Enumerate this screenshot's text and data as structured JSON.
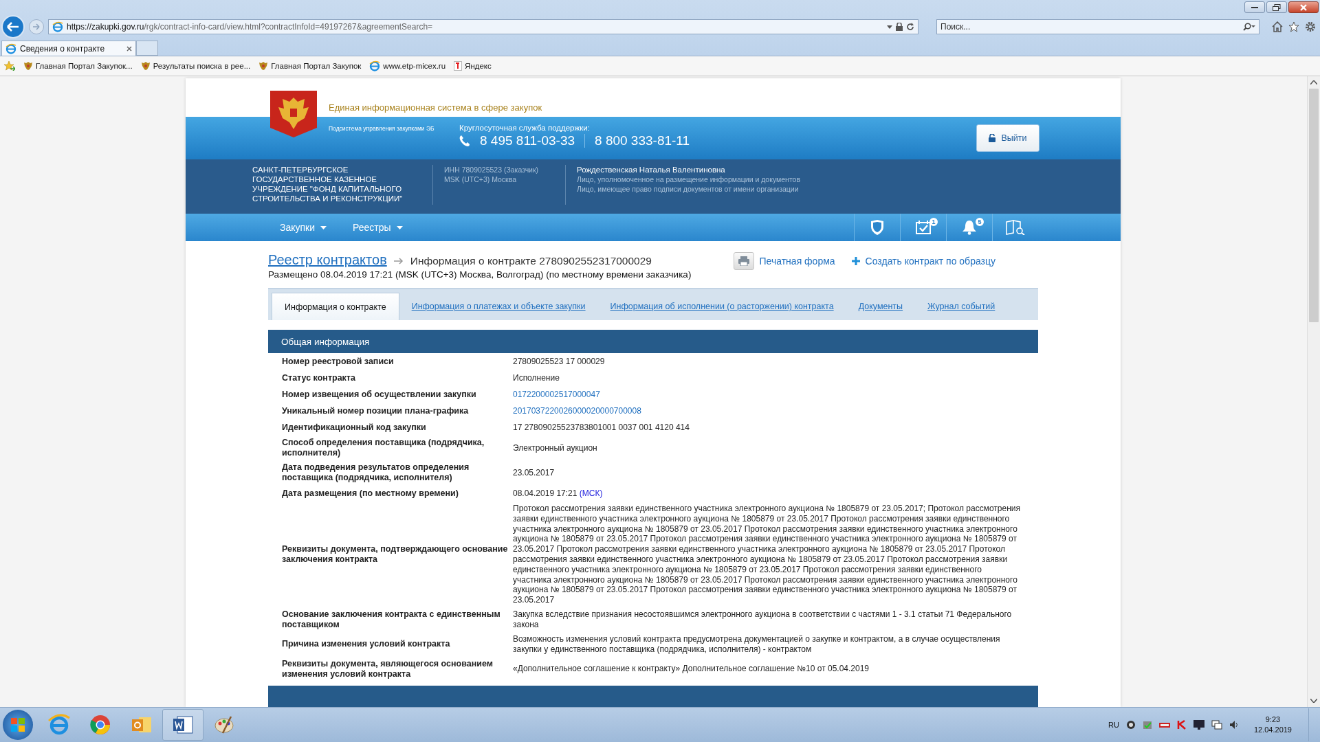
{
  "browser": {
    "url_host": "https://zakupki.gov.ru",
    "url_path": "/rgk/contract-info-card/view.html?contractInfoId=49197267&agreementSearch=",
    "search_placeholder": "Поиск...",
    "tab_title": "Сведения о контракте",
    "favorites": [
      {
        "label": "Главная Портал Закупок...",
        "kind": "emblem"
      },
      {
        "label": "Результаты поиска в рее...",
        "kind": "emblem"
      },
      {
        "label": "Главная Портал Закупок",
        "kind": "emblem"
      },
      {
        "label": "www.etp-micex.ru",
        "kind": "ie"
      },
      {
        "label": "Яндекс",
        "kind": "yandex"
      }
    ]
  },
  "site": {
    "title": "Единая информационная система в сфере закупок",
    "subsystem": "Подсистема управления закупками ЭБ",
    "support_label": "Круглосуточная служба поддержки:",
    "phones": [
      "8 495 811-03-33",
      "8 800 333-81-11"
    ],
    "logout": "Выйти"
  },
  "org": {
    "name": "САНКТ-ПЕТЕРБУРГСКОЕ ГОСУДАРСТВЕННОЕ КАЗЕННОЕ УЧРЕЖДЕНИЕ \"ФОНД КАПИТАЛЬНОГО СТРОИТЕЛЬСТВА И РЕКОНСТРУКЦИИ\"",
    "inn": "ИНН 7809025523 (Заказчик)",
    "timezone": "MSK (UTC+3) Москва",
    "user": "Рождественская Наталья Валентиновна",
    "roles": [
      "Лицо, уполномоченное на размещение информации и документов",
      "Лицо, имеющее право подписи документов от имени организации"
    ]
  },
  "nav": {
    "menus": [
      "Закупки",
      "Реестры"
    ],
    "calendar_badge": "1",
    "bell_badge": "5"
  },
  "page": {
    "breadcrumb": "Реестр контрактов",
    "title": "Информация о контракте 2780902552317000029",
    "placed": "Размещено 08.04.2019 17:21 (MSK (UTC+3) Москва, Волгоград) (по местному времени заказчика)",
    "print": "Печатная форма",
    "create": "Создать контракт по образцу"
  },
  "tabs": [
    {
      "label": "Информация о контракте",
      "selected": true
    },
    {
      "label": "Информация о платежах и объекте закупки",
      "selected": false
    },
    {
      "label": "Информация об исполнении (о расторжении) контракта",
      "selected": false
    },
    {
      "label": "Документы",
      "selected": false
    },
    {
      "label": "Журнал событий",
      "selected": false
    }
  ],
  "section": {
    "title": "Общая информация",
    "rows": [
      {
        "label": "Номер реестровой записи",
        "value": "27809025523 17 000029",
        "kind": "text"
      },
      {
        "label": "Статус контракта",
        "value": "Исполнение",
        "kind": "text"
      },
      {
        "label": "Номер извещения об осуществлении закупки",
        "value": "0172200002517000047",
        "kind": "link"
      },
      {
        "label": "Уникальный номер позиции плана-графика",
        "value": "2017037220026000020000700008",
        "kind": "link"
      },
      {
        "label": "Идентификационный код закупки",
        "value": "17 27809025523783801001 0037 001 4120 414",
        "kind": "text"
      },
      {
        "label": "Способ определения поставщика (подрядчика, исполнителя)",
        "value": "Электронный аукцион",
        "kind": "text"
      },
      {
        "label": "Дата подведения результатов определения поставщика (подрядчика, исполнителя)",
        "value": "23.05.2017",
        "kind": "text"
      },
      {
        "label": "Дата размещения (по местному времени)",
        "value": "08.04.2019 17:21",
        "zone": "(МСК)",
        "kind": "time"
      },
      {
        "label": "Реквизиты документа, подтверждающего основание заключения контракта",
        "value": "Протокол рассмотрения заявки единственного участника электронного аукциона № 1805879 от 23.05.2017; Протокол рассмотрения заявки единственного участника электронного аукциона № 1805879 от 23.05.2017 Протокол рассмотрения заявки единственного участника электронного аукциона № 1805879 от 23.05.2017 Протокол рассмотрения заявки единственного участника электронного аукциона № 1805879 от 23.05.2017 Протокол рассмотрения заявки единственного участника электронного аукциона № 1805879 от 23.05.2017 Протокол рассмотрения заявки единственного участника электронного аукциона № 1805879 от 23.05.2017 Протокол рассмотрения заявки единственного участника электронного аукциона № 1805879 от 23.05.2017 Протокол рассмотрения заявки единственного участника электронного аукциона № 1805879 от 23.05.2017 Протокол рассмотрения заявки единственного участника электронного аукциона № 1805879 от 23.05.2017 Протокол рассмотрения заявки единственного участника электронного аукциона № 1805879 от 23.05.2017 Протокол рассмотрения заявки единственного участника электронного аукциона № 1805879 от 23.05.2017",
        "kind": "text"
      },
      {
        "label": "Основание заключения контракта с единственным поставщиком",
        "value": "Закупка вследствие признания несостоявшимся электронного аукциона в соответствии с частями 1 - 3.1 статьи 71 Федерального закона",
        "kind": "text"
      },
      {
        "label": "Причина изменения условий контракта",
        "value": "Возможность изменения условий контракта предусмотрена документацией о закупке и контрактом, а в случае осуществления закупки у единственного поставщика (подрядчика, исполнителя) - контрактом",
        "kind": "text"
      },
      {
        "label": "Реквизиты документа, являющегося основанием изменения условий контракта",
        "value": "«Дополнительное соглашение к контракту» Дополнительное соглашение №10 от 05.04.2019",
        "kind": "text"
      }
    ]
  },
  "taskbar": {
    "language": "RU",
    "time": "9:23",
    "date": "12.04.2019"
  }
}
